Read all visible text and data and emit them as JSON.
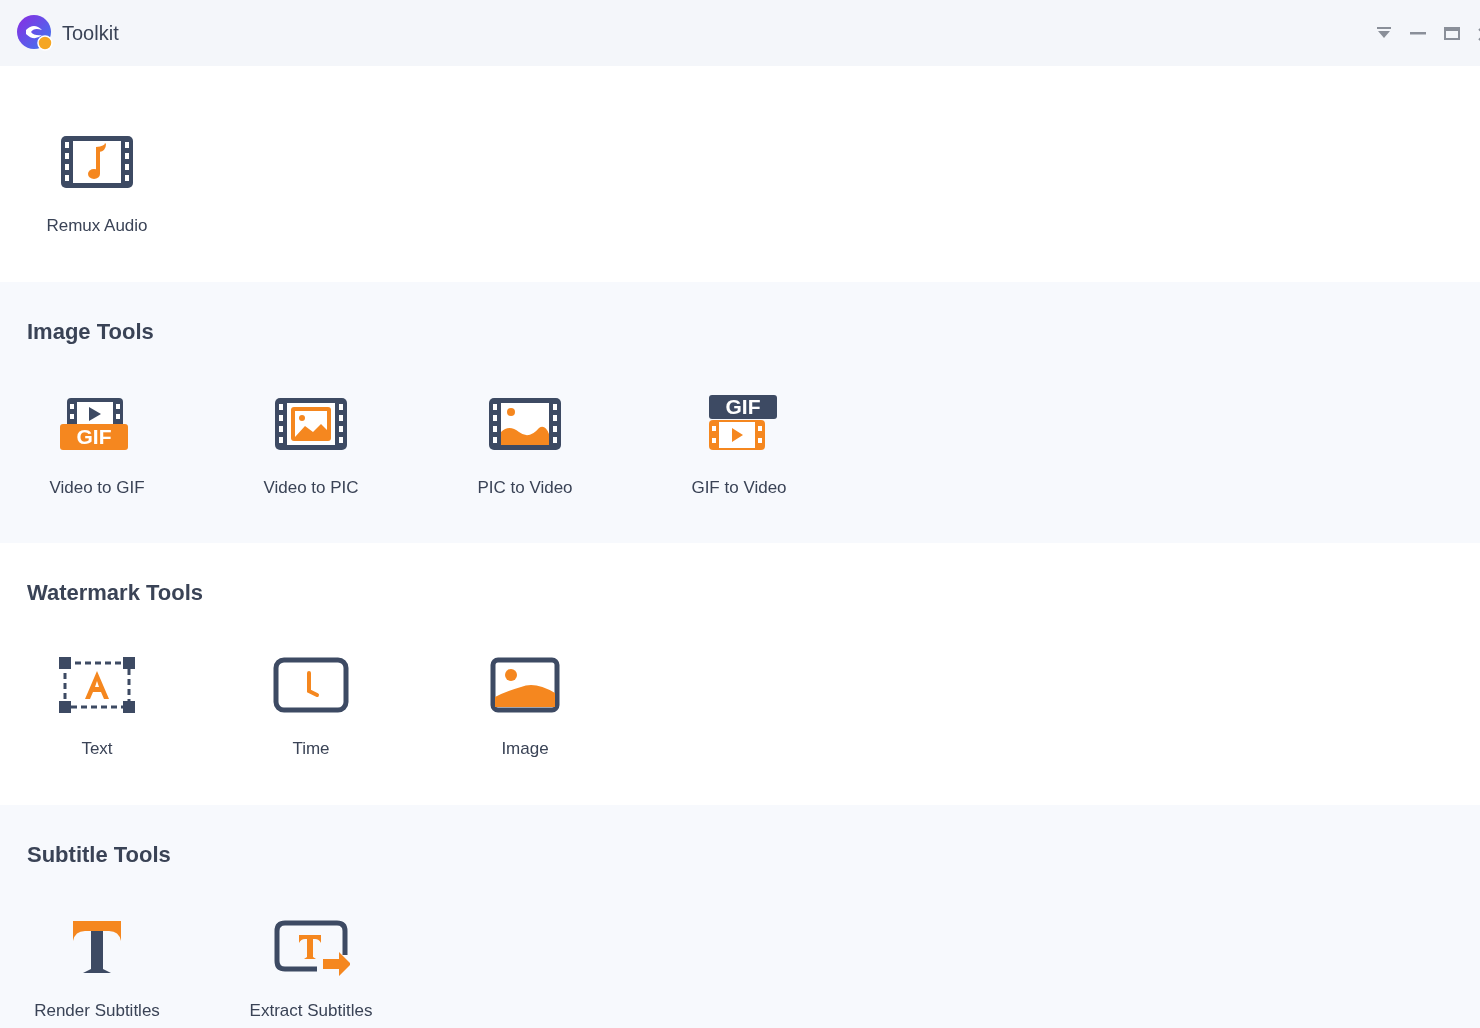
{
  "window": {
    "title": "Toolkit"
  },
  "sections": [
    {
      "tools": [
        {
          "kind": "remux",
          "label": "Remux Audio"
        }
      ]
    },
    {
      "title": "Image Tools",
      "tools": [
        {
          "kind": "gifmaker",
          "label": "Video to GIF",
          "badge": "GIF"
        },
        {
          "kind": "snapshot",
          "label": "Video to PIC"
        },
        {
          "kind": "slideshow",
          "label": "PIC to Video"
        },
        {
          "kind": "gifvideo",
          "label": "GIF to Video",
          "badge": "GIF"
        }
      ]
    },
    {
      "title": "Watermark Tools",
      "tools": [
        {
          "kind": "textmark",
          "label": "Text"
        },
        {
          "kind": "timemark",
          "label": "Time"
        },
        {
          "kind": "imagemark",
          "label": "Image"
        }
      ]
    },
    {
      "title": "Subtitle Tools",
      "tools": [
        {
          "kind": "render",
          "label": "Render Subtitles"
        },
        {
          "kind": "extract",
          "label": "Extract Subtitles"
        }
      ]
    }
  ]
}
